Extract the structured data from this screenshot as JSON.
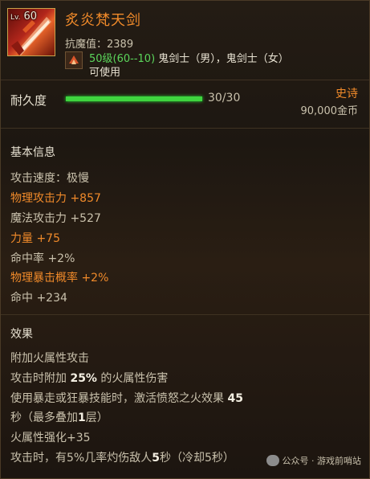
{
  "item": {
    "level_label": "Lv.",
    "level": "60",
    "name": "炙炎梵天剑",
    "resist": "抗魔值：2389",
    "req_level": "50级(60--10)",
    "req_classes": "鬼剑士（男），鬼剑士（女）",
    "usable": "可使用"
  },
  "durability": {
    "label": "耐久度",
    "value": "30/30",
    "fill_fraction": 1.0
  },
  "rarity": "史诗",
  "price": "90,000金币",
  "basic": {
    "title": "基本信息",
    "stats": [
      {
        "label": "攻击速度：极慢"
      },
      {
        "label": "物理攻击力 +857"
      },
      {
        "label": "魔法攻击力 +527"
      },
      {
        "label": "力量 +75"
      },
      {
        "label": "命中率 +2%"
      },
      {
        "label": "物理暴击概率 +2%"
      },
      {
        "label": "命中 +234"
      }
    ]
  },
  "effects": {
    "title": "效果",
    "lines": [
      "附加火属性攻击",
      {
        "pre": "攻击时附加 ",
        "bold": "25%",
        "post": " 的火属性伤害"
      },
      {
        "pre": "使用暴走或狂暴技能时，激活愤怒之火效果 ",
        "bold": "45",
        "post": ""
      },
      {
        "pre": "秒（最多叠加",
        "bold": "1",
        "post": "层）"
      },
      "火属性强化+35",
      {
        "pre": "攻击时，有5%几率灼伤敌人",
        "bold": "5",
        "post": "秒（冷却5秒）"
      }
    ]
  },
  "watermark": "公众号 · 游戏前哨站",
  "colors": {
    "name": "#f08a2a",
    "highlight": "#f08a2a",
    "req_green": "#5bd65b",
    "bar_green": "#3fd43f"
  }
}
